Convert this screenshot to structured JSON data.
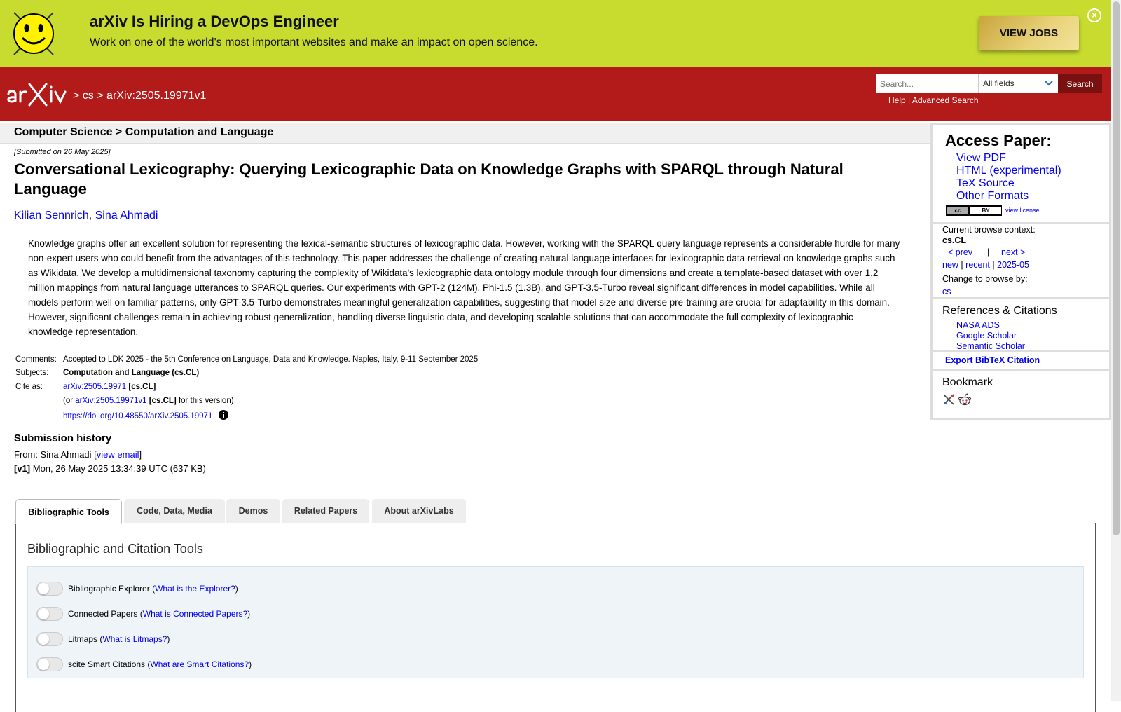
{
  "banner": {
    "title": "arXiv Is Hiring a DevOps Engineer",
    "subtitle": "Work on one of the world's most important websites and make an impact on open science.",
    "cta_label": "VIEW JOBS",
    "close_glyph": "×"
  },
  "header": {
    "breadcrumb": [
      ">",
      "cs",
      ">",
      "arXiv:2505.19971v1"
    ],
    "search_placeholder": "Search...",
    "field_select": "All fields",
    "search_button": "Search",
    "help": "Help",
    "separator": "|",
    "advanced": "Advanced Search"
  },
  "subject_bar": "Computer Science > Computation and Language",
  "paper": {
    "submitted": "[Submitted on 26 May 2025]",
    "title": "Conversational Lexicography: Querying Lexicographic Data on Knowledge Graphs with SPARQL through Natural Language",
    "authors": [
      "Kilian Sennrich",
      "Sina Ahmadi"
    ],
    "author_sep": ", ",
    "abstract": "Knowledge graphs offer an excellent solution for representing the lexical-semantic structures of lexicographic data. However, working with the SPARQL query language represents a considerable hurdle for many non-expert users who could benefit from the advantages of this technology. This paper addresses the challenge of creating natural language interfaces for lexicographic data retrieval on knowledge graphs such as Wikidata. We develop a multidimensional taxonomy capturing the complexity of Wikidata's lexicographic data ontology module through four dimensions and create a template-based dataset with over 1.2 million mappings from natural language utterances to SPARQL queries. Our experiments with GPT-2 (124M), Phi-1.5 (1.3B), and GPT-3.5-Turbo reveal significant differences in model capabilities. While all models perform well on familiar patterns, only GPT-3.5-Turbo demonstrates meaningful generalization capabilities, suggesting that model size and diverse pre-training are crucial for adaptability in this domain. However, significant challenges remain in achieving robust generalization, handling diverse linguistic data, and developing scalable solutions that can accommodate the full complexity of lexicographic knowledge representation.",
    "comments_label": "Comments:",
    "comments": "Accepted to LDK 2025 - the 5th Conference on Language, Data and Knowledge. Naples, Italy, 9-11 September 2025",
    "subjects_label": "Subjects:",
    "subjects": "Computation and Language (cs.CL)",
    "cite_label": "Cite as:",
    "cite_id": "arXiv:2505.19971",
    "cite_cat": "[cs.CL]",
    "cite_ver_pre": "(or ",
    "cite_ver_id": "arXiv:2505.19971v1",
    "cite_ver_cat": "[cs.CL]",
    "cite_ver_post": " for this version)",
    "doi": "https://doi.org/10.48550/arXiv.2505.19971"
  },
  "history": {
    "heading": "Submission history",
    "from_pre": "From: Sina Ahmadi [",
    "view_email": "view email",
    "from_post": "]",
    "v1_tag": "[v1]",
    "v1_text": " Mon, 26 May 2025 13:34:39 UTC (637 KB)"
  },
  "tabs": [
    "Bibliographic Tools",
    "Code, Data, Media",
    "Demos",
    "Related Papers",
    "About arXivLabs"
  ],
  "panel": {
    "heading": "Bibliographic and Citation Tools",
    "toggles": [
      {
        "label": "Bibliographic Explorer",
        "link": "What is the Explorer?"
      },
      {
        "label": "Connected Papers",
        "link": "What is Connected Papers?"
      },
      {
        "label": "Litmaps",
        "link": "What is Litmaps?"
      },
      {
        "label": "scite Smart Citations",
        "link": "What are Smart Citations?"
      }
    ]
  },
  "sidebar": {
    "access_heading": "Access Paper:",
    "access_links": [
      "View PDF",
      "HTML (experimental)",
      "TeX Source",
      "Other Formats"
    ],
    "license_cc": "cc",
    "license_by": "BY",
    "view_license": "view license",
    "context_label": "Current browse context:",
    "context_value": "cs.CL",
    "prev": "< prev",
    "nav_sep": "|",
    "next": "next >",
    "new": "new",
    "recent": "recent",
    "month": "2025-05",
    "change_label": "Change to browse by:",
    "change_value": "cs",
    "refs_heading": "References & Citations",
    "refs": [
      "NASA ADS",
      "Google Scholar",
      "Semantic Scholar"
    ],
    "bibtex": "Export BibTeX Citation",
    "bookmark_heading": "Bookmark"
  },
  "colors": {
    "banner_bg": "#c7dc2f",
    "header_red": "#b31b1b",
    "link_blue": "#0000ee",
    "search_button": "#7a1111"
  }
}
